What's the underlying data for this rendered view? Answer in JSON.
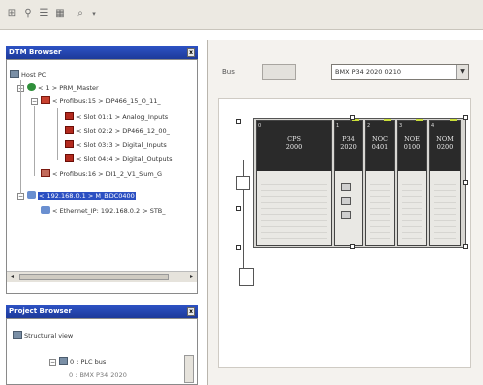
{
  "toolbar": {
    "buttons": [
      "tree-icon",
      "network-icon",
      "list-icon",
      "properties-icon",
      "zoom-icon"
    ]
  },
  "dtm_browser": {
    "title": "DTM Browser",
    "pin": "x",
    "tree": [
      {
        "label": "Host PC",
        "icon": "pc-icon"
      },
      {
        "label": "< 1 > PRM_Master",
        "icon": "master-icon"
      },
      {
        "label": "< Profibus:15 > DP466_15_0_11_",
        "icon": "device-icon"
      },
      {
        "label": "< Slot 01:1 > Analog_Inputs",
        "icon": "slot-icon"
      },
      {
        "label": "< Slot 02:2 > DP466_12_00_",
        "icon": "slot-icon"
      },
      {
        "label": "< Slot 03:3 > Digital_Inputs",
        "icon": "slot-icon"
      },
      {
        "label": "< Slot 04:4 > Digital_Outputs",
        "icon": "slot-icon"
      },
      {
        "label": "< Profibus:16 > DI1_2_V1_Sum_G",
        "icon": "device-icon"
      },
      {
        "label": "< 192.168.0.1 > M_BDC0400",
        "icon": "network-icon"
      },
      {
        "label": "< Ethernet_IP: 192.168.0.2 > STB_",
        "icon": "network-icon"
      }
    ]
  },
  "project_browser": {
    "title": "Project Browser",
    "pin": "x",
    "structural_view": "Structural view",
    "plc_item": "0 : PLC bus",
    "sub_item": "0 : BMX P34 2020"
  },
  "rack_editor": {
    "bus_label": "Bus",
    "rack_select": "BMX P34 2020 0210",
    "modules": [
      {
        "line1": "CPS",
        "line2": "2000",
        "slot": "0"
      },
      {
        "line1": "P34",
        "line2": "2020",
        "slot": "1"
      },
      {
        "line1": "NOC",
        "line2": "0401",
        "slot": "2"
      },
      {
        "line1": "NOE",
        "line2": "0100",
        "slot": "3"
      },
      {
        "line1": "NOM",
        "line2": "0200",
        "slot": "4"
      }
    ]
  },
  "colors": {
    "panel_title": "#2d52c4",
    "selection": "#2b4fc2",
    "module_head": "#2a2a2a",
    "led": "#cbe03a",
    "slot_icon": "#b32a1e"
  }
}
